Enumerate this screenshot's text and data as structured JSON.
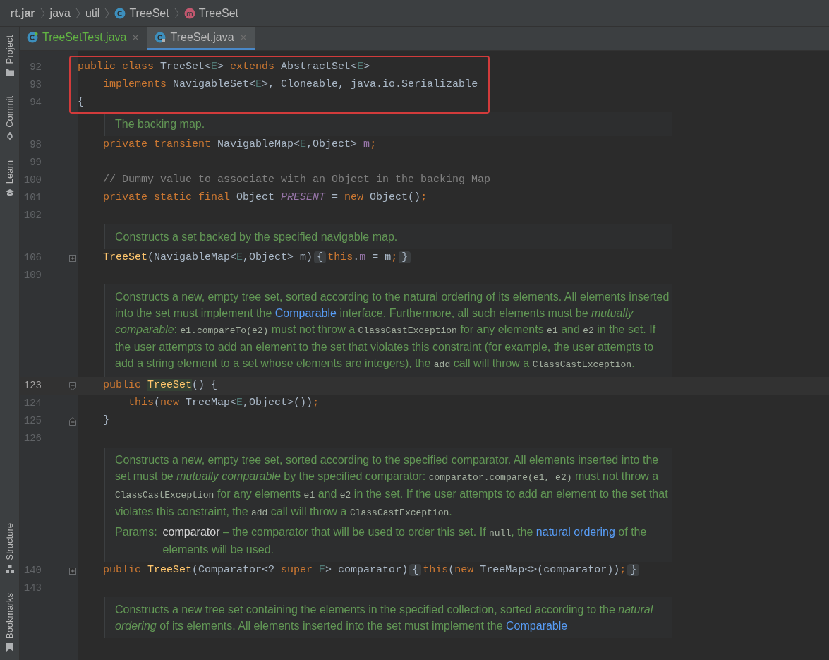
{
  "breadcrumbs": [
    {
      "label": "rt.jar",
      "kind": "archive"
    },
    {
      "label": "java",
      "kind": "package"
    },
    {
      "label": "util",
      "kind": "package"
    },
    {
      "label": "TreeSet",
      "kind": "class"
    },
    {
      "label": "TreeSet",
      "kind": "method"
    }
  ],
  "tabs": [
    {
      "label": "TreeSetTest.java",
      "selected": false,
      "modified": true
    },
    {
      "label": "TreeSet.java",
      "selected": true,
      "modified": false
    }
  ],
  "tool_windows_top": [
    {
      "label": "Project",
      "kind": "folder"
    },
    {
      "label": "Commit",
      "kind": "commit"
    },
    {
      "label": "Learn",
      "kind": "learn"
    }
  ],
  "tool_windows_bottom": [
    {
      "label": "Structure",
      "kind": "structure"
    },
    {
      "label": "Bookmarks",
      "kind": "bookmark"
    }
  ],
  "editor": [
    {
      "kind": "highlight",
      "lines": [
        {
          "number": "92",
          "tokens": [
            {
              "kind": "kw",
              "t": "public class "
            },
            {
              "kind": "plain",
              "t": "TreeSet<"
            },
            {
              "kind": "tparam",
              "t": "E"
            },
            {
              "kind": "plain",
              "t": "> "
            },
            {
              "kind": "kw",
              "t": "extends "
            },
            {
              "kind": "plain",
              "t": "AbstractSet<"
            },
            {
              "kind": "tparam",
              "t": "E"
            },
            {
              "kind": "plain",
              "t": ">"
            }
          ]
        },
        {
          "number": "93",
          "tokens": [
            {
              "kind": "kw",
              "t": "    implements "
            },
            {
              "kind": "plain",
              "t": "NavigableSet<"
            },
            {
              "kind": "tparam",
              "t": "E"
            },
            {
              "kind": "plain",
              "t": ">, Cloneable, java.io.Serializable"
            }
          ]
        },
        {
          "number": "94",
          "tokens": [
            {
              "kind": "plain",
              "t": "{"
            }
          ]
        }
      ]
    },
    {
      "kind": "doc",
      "paras": [
        {
          "kind": "para",
          "segments": [
            {
              "kind": "text",
              "t": "The backing map."
            }
          ]
        }
      ]
    },
    {
      "kind": "code",
      "number": "98",
      "tokens": [
        {
          "kind": "kw",
          "t": "    private transient "
        },
        {
          "kind": "plain",
          "t": "NavigableMap<"
        },
        {
          "kind": "tparam",
          "t": "E"
        },
        {
          "kind": "plain",
          "t": ",Object> "
        },
        {
          "kind": "field",
          "t": "m"
        },
        {
          "kind": "kw",
          "t": ";"
        }
      ]
    },
    {
      "kind": "code",
      "number": "99"
    },
    {
      "kind": "code",
      "number": "100",
      "tokens": [
        {
          "kind": "comment",
          "t": "    // Dummy value to associate with an Object in the backing Map"
        }
      ]
    },
    {
      "kind": "code",
      "number": "101",
      "tokens": [
        {
          "kind": "kw",
          "t": "    private static final "
        },
        {
          "kind": "plain",
          "t": "Object "
        },
        {
          "kind": "static",
          "t": "PRESENT"
        },
        {
          "kind": "plain",
          "t": " = "
        },
        {
          "kind": "kw",
          "t": "new "
        },
        {
          "kind": "plain",
          "t": "Object()"
        },
        {
          "kind": "kw",
          "t": ";"
        }
      ]
    },
    {
      "kind": "code",
      "number": "102"
    },
    {
      "kind": "doc",
      "paras": [
        {
          "kind": "para",
          "segments": [
            {
              "kind": "text",
              "t": "Constructs a set backed by the specified navigable map."
            }
          ]
        }
      ]
    },
    {
      "kind": "code",
      "number": "106",
      "fold": {
        "kind": "collapsed"
      },
      "tokens": [
        {
          "kind": "decl",
          "t": "    TreeSet"
        },
        {
          "kind": "plain",
          "t": "(NavigableMap<"
        },
        {
          "kind": "tparam",
          "t": "E"
        },
        {
          "kind": "plain",
          "t": ",Object> m)"
        },
        {
          "kind": "fold",
          "t": "{"
        },
        {
          "kind": "kw",
          "t": "this"
        },
        {
          "kind": "plain",
          "t": "."
        },
        {
          "kind": "field",
          "t": "m"
        },
        {
          "kind": "plain",
          "t": " = m"
        },
        {
          "kind": "kw",
          "t": ";"
        },
        {
          "kind": "fold",
          "t": "}"
        }
      ]
    },
    {
      "kind": "code",
      "number": "109"
    },
    {
      "kind": "doc",
      "paras": [
        {
          "kind": "para",
          "segments": [
            {
              "kind": "text",
              "t": "Constructs a new, empty tree set, sorted according to the natural ordering of its elements. All elements inserted into the set must implement the "
            },
            {
              "kind": "link",
              "t": "Comparable"
            },
            {
              "kind": "text",
              "t": " interface. Furthermore, all such elements must be "
            },
            {
              "kind": "em",
              "t": "mutually comparable"
            },
            {
              "kind": "text",
              "t": ": "
            },
            {
              "kind": "code",
              "t": "e1.compareTo(e2)"
            },
            {
              "kind": "text",
              "t": " must not throw a "
            },
            {
              "kind": "code",
              "t": "ClassCastException"
            },
            {
              "kind": "text",
              "t": " for any elements "
            },
            {
              "kind": "code",
              "t": "e1"
            },
            {
              "kind": "text",
              "t": " and "
            },
            {
              "kind": "code",
              "t": "e2"
            },
            {
              "kind": "text",
              "t": " in the set. If the user attempts to add an element to the set that violates this constraint (for example, the user attempts to add a string element to a set whose elements are integers), the "
            },
            {
              "kind": "code",
              "t": "add"
            },
            {
              "kind": "text",
              "t": " call will throw a "
            },
            {
              "kind": "code",
              "t": "ClassCastException"
            },
            {
              "kind": "text",
              "t": "."
            }
          ]
        }
      ]
    },
    {
      "kind": "code",
      "number": "123",
      "current": true,
      "fold": {
        "kind": "open"
      },
      "tokens": [
        {
          "kind": "kw",
          "t": "    public "
        },
        {
          "kind": "usage",
          "t": "TreeSet"
        },
        {
          "kind": "plain",
          "t": "() {"
        }
      ]
    },
    {
      "kind": "code",
      "number": "124",
      "current": false,
      "tokens": [
        {
          "kind": "kw",
          "t": "        this"
        },
        {
          "kind": "plain",
          "t": "("
        },
        {
          "kind": "kw",
          "t": "new "
        },
        {
          "kind": "plain",
          "t": "TreeMap<"
        },
        {
          "kind": "tparam",
          "t": "E"
        },
        {
          "kind": "plain",
          "t": ",Object>())"
        },
        {
          "kind": "kw",
          "t": ";"
        }
      ]
    },
    {
      "kind": "code",
      "number": "125",
      "fold": {
        "kind": "close"
      },
      "tokens": [
        {
          "kind": "plain",
          "t": "    }"
        }
      ]
    },
    {
      "kind": "code",
      "number": "126"
    },
    {
      "kind": "doc",
      "paras": [
        {
          "kind": "para",
          "segments": [
            {
              "kind": "text",
              "t": "Constructs a new, empty tree set, sorted according to the specified comparator. All elements inserted into the set must be "
            },
            {
              "kind": "em",
              "t": "mutually comparable"
            },
            {
              "kind": "text",
              "t": " by the specified comparator: "
            },
            {
              "kind": "code",
              "t": "comparator.compare(e1, e2)"
            },
            {
              "kind": "text",
              "t": " must not throw a "
            },
            {
              "kind": "code",
              "t": "ClassCastException"
            },
            {
              "kind": "text",
              "t": " for any elements "
            },
            {
              "kind": "code",
              "t": "e1"
            },
            {
              "kind": "text",
              "t": " and "
            },
            {
              "kind": "code",
              "t": "e2"
            },
            {
              "kind": "text",
              "t": " in the set. If the user attempts to add an element to the set that violates this constraint, the "
            },
            {
              "kind": "code",
              "t": "add"
            },
            {
              "kind": "text",
              "t": " call will throw a "
            },
            {
              "kind": "code",
              "t": "ClassCastException"
            },
            {
              "kind": "text",
              "t": "."
            }
          ]
        },
        {
          "kind": "params",
          "label": "Params:",
          "segments": [
            {
              "kind": "name",
              "t": "comparator"
            },
            {
              "kind": "text",
              "t": " – the comparator that will be used to order this set. If "
            },
            {
              "kind": "code",
              "t": "null"
            },
            {
              "kind": "text",
              "t": ", the "
            },
            {
              "kind": "link",
              "t": "natural ordering"
            },
            {
              "kind": "text",
              "t": " of the elements will be used."
            }
          ]
        }
      ]
    },
    {
      "kind": "code",
      "number": "140",
      "fold": {
        "kind": "collapsed"
      },
      "tokens": [
        {
          "kind": "kw",
          "t": "    public "
        },
        {
          "kind": "decl",
          "t": "TreeSet"
        },
        {
          "kind": "plain",
          "t": "(Comparator<? "
        },
        {
          "kind": "kw",
          "t": "super "
        },
        {
          "kind": "tparam",
          "t": "E"
        },
        {
          "kind": "plain",
          "t": "> comparator)"
        },
        {
          "kind": "fold",
          "t": "{"
        },
        {
          "kind": "kw",
          "t": "this"
        },
        {
          "kind": "plain",
          "t": "("
        },
        {
          "kind": "kw",
          "t": "new "
        },
        {
          "kind": "plain",
          "t": "TreeMap<>(comparator))"
        },
        {
          "kind": "kw",
          "t": ";"
        },
        {
          "kind": "fold",
          "t": "}"
        }
      ]
    },
    {
      "kind": "code",
      "number": "143"
    },
    {
      "kind": "doc",
      "paras": [
        {
          "kind": "para",
          "segments": [
            {
              "kind": "text",
              "t": "Constructs a new tree set containing the elements in the specified collection, sorted according to the "
            },
            {
              "kind": "em",
              "t": "natural ordering"
            },
            {
              "kind": "text",
              "t": " of its elements. All elements inserted into the set must implement the "
            },
            {
              "kind": "link",
              "t": "Comparable"
            }
          ]
        }
      ]
    }
  ]
}
